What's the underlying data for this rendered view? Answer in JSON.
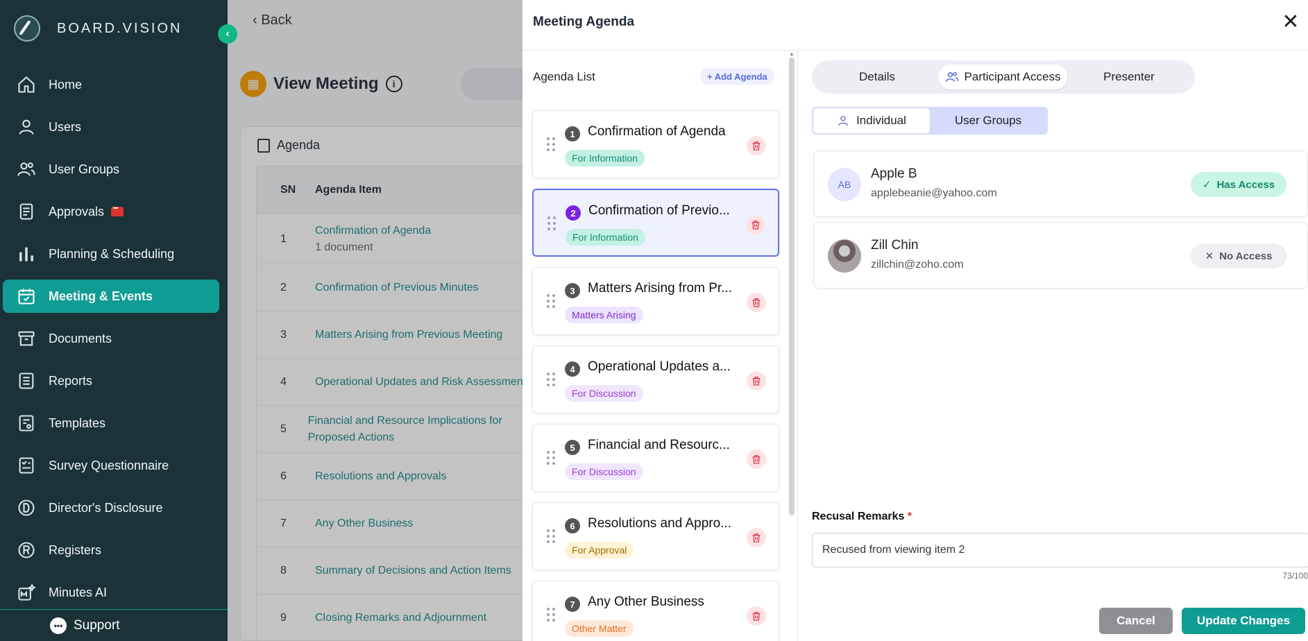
{
  "brand": {
    "name": "BOARD.VISION"
  },
  "sidebar": {
    "items": [
      {
        "label": "Home",
        "icon": "home-icon"
      },
      {
        "label": "Users",
        "icon": "user-icon"
      },
      {
        "label": "User Groups",
        "icon": "users-icon"
      },
      {
        "label": "Approvals",
        "icon": "clipboard-icon"
      },
      {
        "label": "Planning & Scheduling",
        "icon": "bar-chart-icon"
      },
      {
        "label": "Meeting & Events",
        "icon": "calendar-check-icon"
      },
      {
        "label": "Documents",
        "icon": "archive-icon"
      },
      {
        "label": "Reports",
        "icon": "list-icon"
      },
      {
        "label": "Templates",
        "icon": "template-icon"
      },
      {
        "label": "Survey Questionnaire",
        "icon": "checklist-icon"
      },
      {
        "label": "Director's Disclosure",
        "icon": "d-circle-icon"
      },
      {
        "label": "Registers",
        "icon": "r-circle-icon"
      },
      {
        "label": "Minutes AI",
        "icon": "minutes-ai-icon"
      }
    ],
    "support_label": "Support"
  },
  "main": {
    "back_label": "Back",
    "page_title": "View Meeting",
    "agenda_section_title": "Agenda",
    "table": {
      "headers": [
        "SN",
        "Agenda Item"
      ],
      "rows": [
        {
          "sn": "1",
          "item": "Confirmation of Agenda",
          "sub": "1 document"
        },
        {
          "sn": "2",
          "item": "Confirmation of Previous Minutes",
          "sub": ""
        },
        {
          "sn": "3",
          "item": "Matters Arising from Previous Meeting",
          "sub": ""
        },
        {
          "sn": "4",
          "item": "Operational Updates and Risk Assessment",
          "sub": ""
        },
        {
          "sn": "5",
          "item": "Financial and Resource Implications for Proposed Actions",
          "sub": ""
        },
        {
          "sn": "6",
          "item": "Resolutions and Approvals",
          "sub": ""
        },
        {
          "sn": "7",
          "item": "Any Other Business",
          "sub": ""
        },
        {
          "sn": "8",
          "item": "Summary of Decisions and Action Items",
          "sub": ""
        },
        {
          "sn": "9",
          "item": "Closing Remarks and Adjournment",
          "sub": ""
        }
      ]
    }
  },
  "modal": {
    "title": "Meeting Agenda",
    "agenda_list_label": "Agenda List",
    "add_agenda_label": "+ Add Agenda",
    "items": [
      {
        "num": "1",
        "title": "Confirmation of Agenda",
        "tag": "For Information"
      },
      {
        "num": "2",
        "title": "Confirmation of Previo...",
        "tag": "For Information"
      },
      {
        "num": "3",
        "title": "Matters Arising from Pr...",
        "tag": "Matters Arising"
      },
      {
        "num": "4",
        "title": "Operational Updates a...",
        "tag": "For Discussion"
      },
      {
        "num": "5",
        "title": "Financial and Resourc...",
        "tag": "For Discussion"
      },
      {
        "num": "6",
        "title": "Resolutions and Appro...",
        "tag": "For Approval"
      },
      {
        "num": "7",
        "title": "Any Other Business",
        "tag": "Other Matter"
      }
    ],
    "tabs": [
      "Details",
      "Participant Access",
      "Presenter"
    ],
    "subtabs": [
      "Individual",
      "User Groups"
    ],
    "participants": [
      {
        "initials": "AB",
        "name": "Apple B",
        "email": "applebeanie@yahoo.com",
        "access": "Has Access"
      },
      {
        "initials": "",
        "name": "Zill Chin",
        "email": "zillchin@zoho.com",
        "access": "No Access"
      }
    ],
    "remarks_label": "Recusal Remarks",
    "remarks_required": "*",
    "remarks_value": "Recused from viewing item 2",
    "remarks_counter": "73/100",
    "cancel_label": "Cancel",
    "update_label": "Update Changes"
  }
}
